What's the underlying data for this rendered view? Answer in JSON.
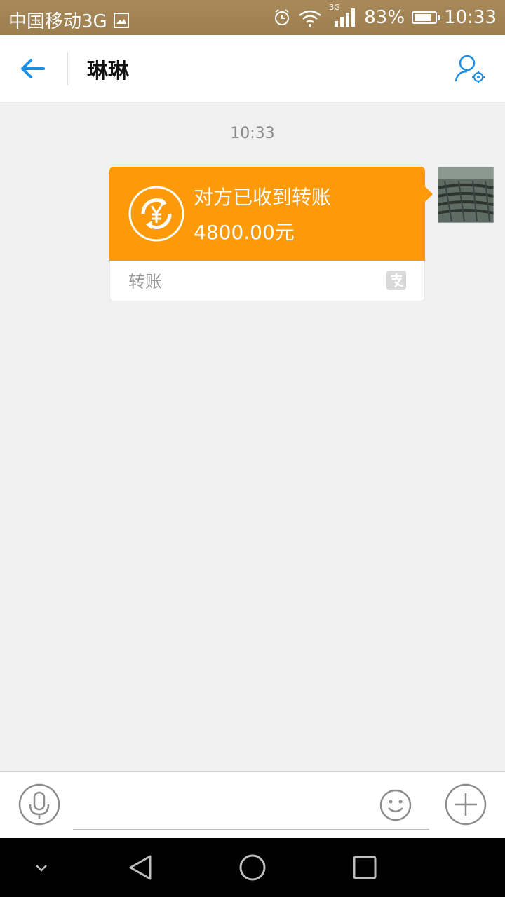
{
  "status_bar": {
    "carrier": "中国移动3G",
    "network": "3G",
    "battery": "83%",
    "battery_level": 0.83,
    "time": "10:33"
  },
  "header": {
    "title": "琳琳",
    "back_icon": "arrow-left-icon",
    "profile_icon": "user-settings-icon",
    "accent_color": "#1b8fe6"
  },
  "chat": {
    "timestamp": "10:33",
    "messages": [
      {
        "type": "transfer",
        "direction": "outgoing",
        "status_text": "对方已收到转账",
        "amount": "4800.00元",
        "footer_label": "转账",
        "card_color": "#fd9a0a",
        "icon": "yuan-refund-icon",
        "brand_icon": "alipay-icon"
      }
    ]
  },
  "input_bar": {
    "placeholder": "",
    "value": "",
    "voice_icon": "microphone-icon",
    "emoji_icon": "smiley-icon",
    "more_icon": "plus-circle-icon"
  },
  "nav_bar": {
    "buttons": [
      "chevron-down-icon",
      "back-triangle-icon",
      "home-circle-icon",
      "recents-square-icon"
    ]
  }
}
